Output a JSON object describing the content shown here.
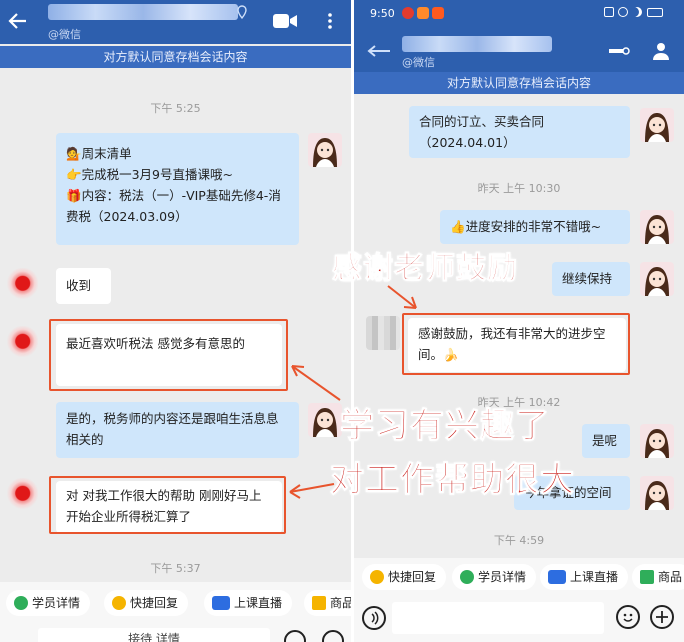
{
  "left": {
    "sub_label": "@微信",
    "banner": "对方默认同意存档会话内容",
    "timestamps": [
      "下午 5:25",
      "下午 5:37"
    ],
    "messages": [
      {
        "lines": "💁周末清单\n👉完成税一3月9号直播课哦~\n🎁内容：税法（一）-VIP基础先修4-消费税（2024.03.09）"
      },
      {
        "lines": "收到"
      },
      {
        "lines": "最近喜欢听税法  感觉多有意思的"
      },
      {
        "lines": "是的，税务师的内容还是跟咱生活息息相关的"
      },
      {
        "lines": "对  对我工作很大的帮助  刚刚好马上开始企业所得税汇算了"
      }
    ],
    "toolbar": [
      "学员详情",
      "快捷回复",
      "上课直播",
      "商品"
    ],
    "input_hint": "接待 详情"
  },
  "right": {
    "status_time": "9:50",
    "status_icons": [
      "weibo-icon",
      "battery-alert-icon",
      "taobao-icon",
      "nfc-icon",
      "alarm-icon",
      "moon-icon",
      "battery-icon"
    ],
    "sub_label": "@微信",
    "banner": "对方默认同意存档会话内容",
    "timestamps": [
      "昨天  上午 10:30",
      "昨天  上午 10:42",
      "下午 4:59"
    ],
    "messages": [
      {
        "lines": "合同的订立、买卖合同（2024.04.01）"
      },
      {
        "lines": "👍进度安排的非常不错哦~"
      },
      {
        "lines": "继续保持"
      },
      {
        "lines": "感谢鼓励，我还有非常大的进步空间。🍌"
      },
      {
        "lines": "是呢"
      },
      {
        "lines": "今年拿证的空间"
      }
    ],
    "toolbar": [
      "快捷回复",
      "学员详情",
      "上课直播",
      "商品"
    ]
  },
  "overlays": {
    "top": "感谢老师鼓励",
    "mid": "学习有兴趣了",
    "bottom": "对工作帮助很大"
  },
  "colors": {
    "header": "#2d5fae",
    "banner": "#3a6cc0",
    "bubble_blue": "#cfe6fb",
    "annotation": "#e8542d",
    "overlay_text": "#c8140f"
  }
}
